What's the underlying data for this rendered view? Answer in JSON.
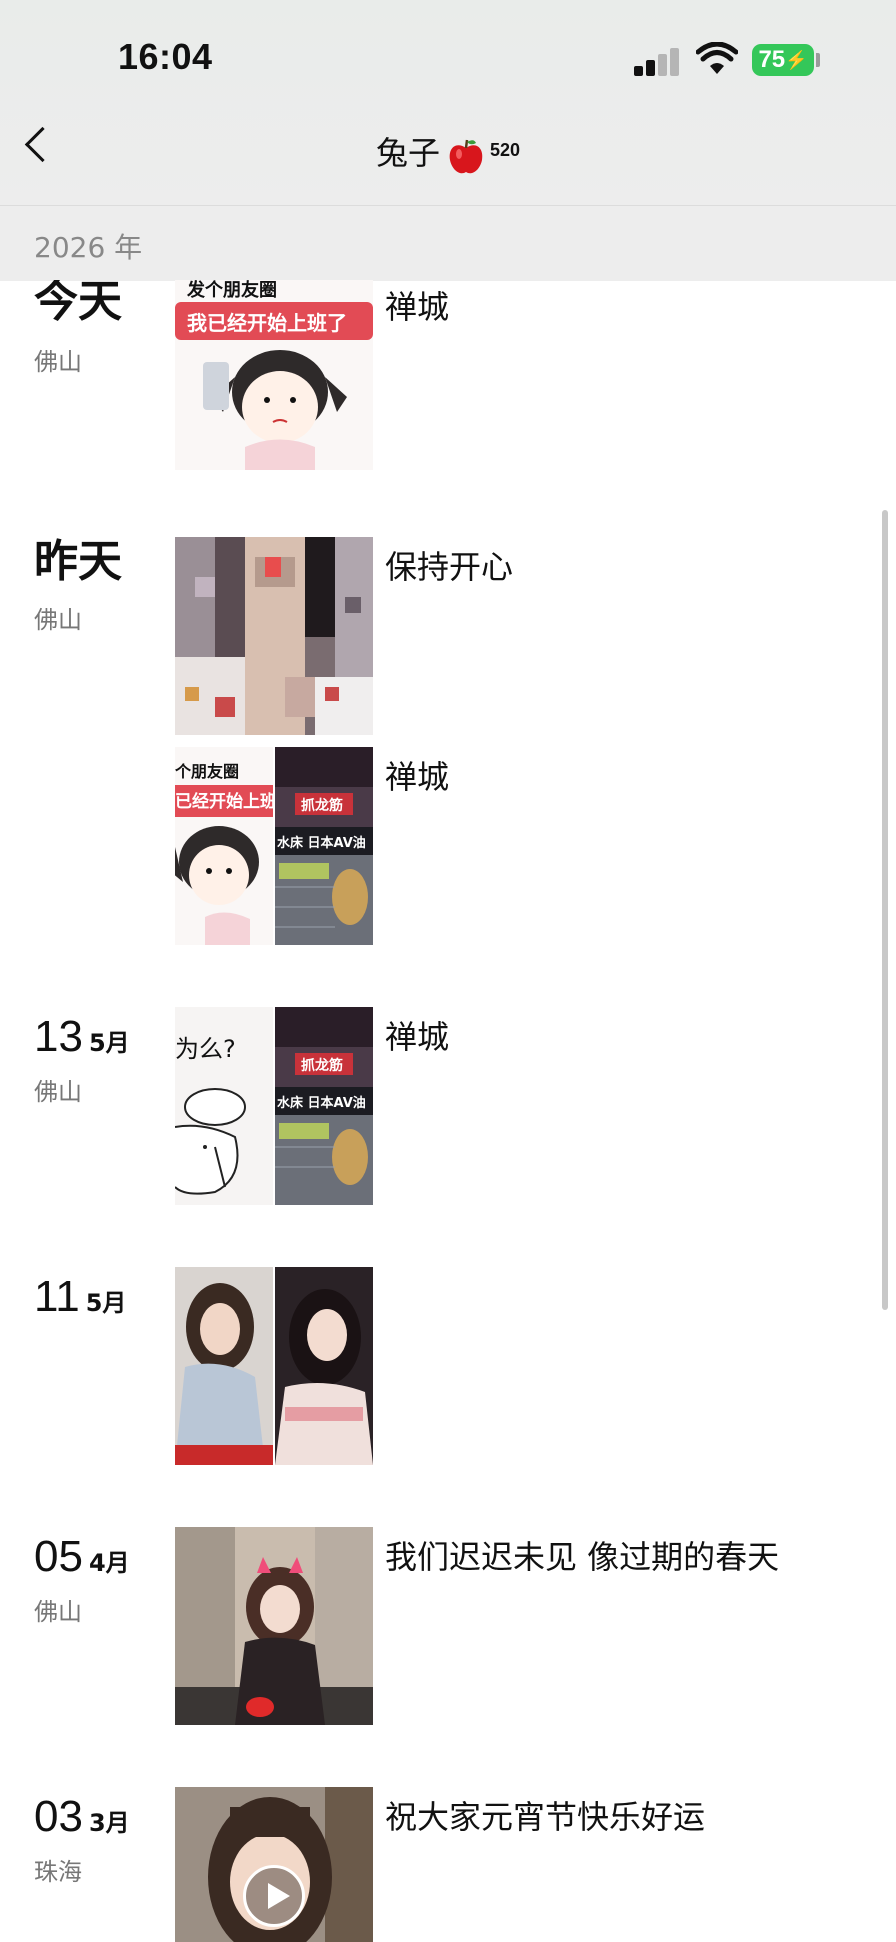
{
  "status": {
    "time": "16:04",
    "battery": "75"
  },
  "header": {
    "title": "兔子",
    "badge": "520"
  },
  "year": "2026 年",
  "posts": [
    {
      "day": "今天",
      "location": "佛山",
      "caption": "禅城",
      "image_text": [
        "发个朋友圈",
        "我已经开始上班了"
      ]
    },
    {
      "day": "昨天",
      "location": "佛山",
      "caption": "保持开心"
    },
    {
      "caption": "禅城",
      "image_text": [
        "个朋友圈",
        "已经开始上班",
        "抓龙筋",
        "水床 日本AV油"
      ]
    },
    {
      "day_num": "13",
      "month": "5月",
      "location": "佛山",
      "caption": "禅城",
      "image_text": [
        "为么?",
        "抓龙筋",
        "水床 日本AV油"
      ]
    },
    {
      "day_num": "11",
      "month": "5月",
      "caption": ""
    },
    {
      "day_num": "05",
      "month": "4月",
      "location": "佛山",
      "caption": "我们迟迟未见 像过期的春天"
    },
    {
      "day_num": "03",
      "month": "3月",
      "location": "珠海",
      "caption": "祝大家元宵节快乐好运"
    }
  ],
  "colors": {
    "battery": "#34c759",
    "header_bg": "#ededed",
    "muted_text": "#777777"
  }
}
